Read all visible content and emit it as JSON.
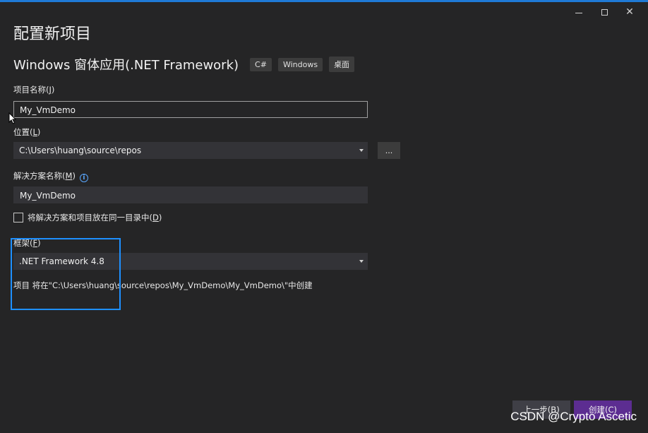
{
  "window": {
    "title": "配置新项目",
    "controls": {
      "minimize": "minimize-icon",
      "maximize": "maximize-icon",
      "close": "close-icon"
    }
  },
  "template": {
    "name": "Windows 窗体应用(.NET Framework)",
    "tags": [
      "C#",
      "Windows",
      "桌面"
    ]
  },
  "project_name": {
    "label": "项目名称(",
    "accel": "J",
    "suffix": ")",
    "value": "My_VmDemo"
  },
  "location": {
    "label": "位置(",
    "accel": "L",
    "suffix": ")",
    "value": "C:\\Users\\huang\\source\\repos",
    "browse_label": "..."
  },
  "solution_name": {
    "label": "解决方案名称(",
    "accel": "M",
    "suffix": ")",
    "value": "My_VmDemo",
    "info_icon": "info-icon"
  },
  "same_dir": {
    "label": "将解决方案和项目放在同一目录中(",
    "accel": "D",
    "suffix": ")",
    "checked": false
  },
  "framework": {
    "label": "框架(",
    "accel": "F",
    "suffix": ")",
    "value": ".NET Framework 4.8"
  },
  "path_info": "项目 将在\"C:\\Users\\huang\\source\\repos\\My_VmDemo\\My_VmDemo\\\"中创建",
  "footer": {
    "back_label": "上一步(B)",
    "create_label": "创建(C)"
  },
  "watermark": "CSDN @Crypto Ascetic",
  "colors": {
    "accent": "#1f7ad6",
    "highlight": "#1e90ff",
    "create_button": "#5c2d91",
    "background": "#252526"
  }
}
